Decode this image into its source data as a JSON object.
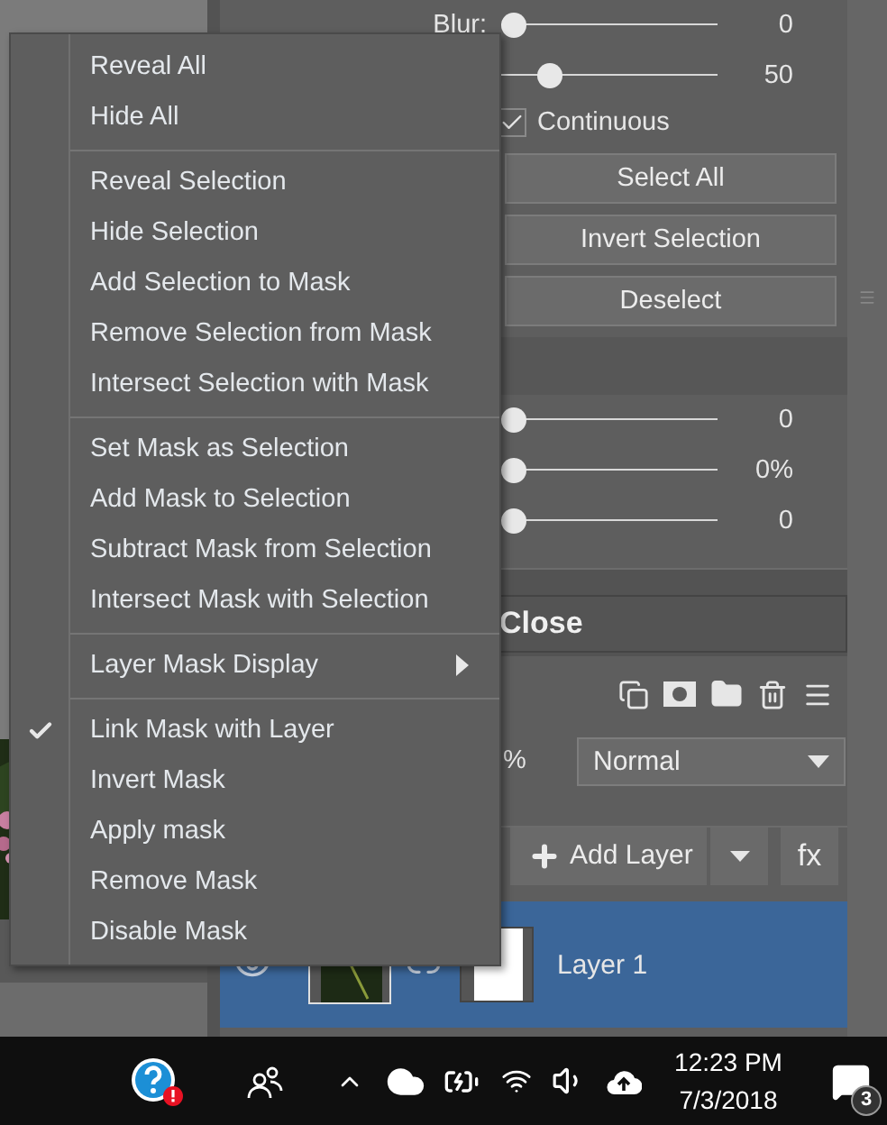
{
  "panel": {
    "sliders_top": [
      {
        "label": "Blur:",
        "level": 0,
        "value": "0"
      },
      {
        "level": 0.19,
        "value": "50"
      }
    ],
    "continuous": {
      "label": "Continuous",
      "checked": true
    },
    "buttons": [
      "Select All",
      "Invert Selection",
      "Deselect"
    ],
    "sliders": [
      {
        "level": 0,
        "value": "0"
      },
      {
        "level": 0,
        "value": "0%"
      },
      {
        "level": 0,
        "value": "0"
      }
    ],
    "close": "Close"
  },
  "layers": {
    "opacity": "%",
    "blend_mode": "Normal",
    "add_layer": "Add Layer",
    "fx": "fx",
    "rows": [
      {
        "name": "Layer 1",
        "selected": true,
        "visible": true
      }
    ]
  },
  "menu": {
    "groups": [
      [
        {
          "label": "Reveal All",
          "checked": false,
          "submenu": false
        },
        {
          "label": "Hide All",
          "checked": false,
          "submenu": false
        }
      ],
      [
        {
          "label": "Reveal Selection",
          "checked": false,
          "submenu": false
        },
        {
          "label": "Hide Selection",
          "checked": false,
          "submenu": false
        },
        {
          "label": "Add Selection to Mask",
          "checked": false,
          "submenu": false
        },
        {
          "label": "Remove Selection from Mask",
          "checked": false,
          "submenu": false
        },
        {
          "label": "Intersect Selection with Mask",
          "checked": false,
          "submenu": false
        }
      ],
      [
        {
          "label": "Set Mask as Selection",
          "checked": false,
          "submenu": false
        },
        {
          "label": "Add Mask to Selection",
          "checked": false,
          "submenu": false
        },
        {
          "label": "Subtract Mask from Selection",
          "checked": false,
          "submenu": false
        },
        {
          "label": "Intersect Mask with Selection",
          "checked": false,
          "submenu": false
        }
      ],
      [
        {
          "label": "Layer Mask Display",
          "checked": false,
          "submenu": true
        }
      ],
      [
        {
          "label": "Link Mask with Layer",
          "checked": true,
          "submenu": false
        },
        {
          "label": "Invert Mask",
          "checked": false,
          "submenu": false
        },
        {
          "label": "Apply mask",
          "checked": false,
          "submenu": false
        },
        {
          "label": "Remove Mask",
          "checked": false,
          "submenu": false
        },
        {
          "label": "Disable Mask",
          "checked": false,
          "submenu": false
        }
      ]
    ]
  },
  "taskbar": {
    "time": "12:23 PM",
    "date": "7/3/2018",
    "notifications": "3"
  }
}
